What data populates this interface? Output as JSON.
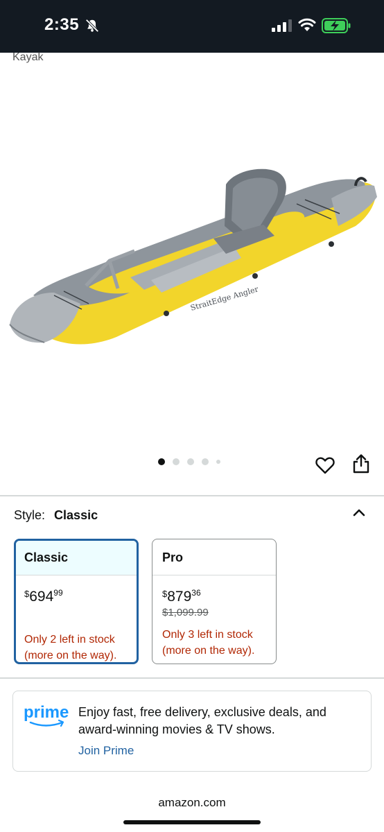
{
  "status_bar": {
    "time": "2:35"
  },
  "product": {
    "breadcrumb": "Kayak",
    "image_alt": "StraitEdge Angler",
    "gallery": {
      "count": 5,
      "active_index": 0
    }
  },
  "style_selector": {
    "label": "Style:",
    "selected": "Classic",
    "options": [
      {
        "name": "Classic",
        "price_symbol": "$",
        "price_whole": "694",
        "price_fraction": "99",
        "stock_line1": "Only 2 left in stock",
        "stock_line2": "(more on the way)."
      },
      {
        "name": "Pro",
        "price_symbol": "$",
        "price_whole": "879",
        "price_fraction": "36",
        "list_price": "$1,099.99",
        "stock_line1": "Only 3 left in stock",
        "stock_line2": "(more on the way)."
      }
    ]
  },
  "prime": {
    "logo": "prime",
    "text": "Enjoy fast, free delivery, exclusive deals, and award-winning movies & TV shows.",
    "cta": "Join Prime"
  },
  "browser": {
    "url": "amazon.com"
  },
  "colors": {
    "status_bar_bg": "#131a22",
    "link_blue": "#2162a1",
    "stock_red": "#b12704",
    "kayak_yellow": "#f2d52b",
    "kayak_gray": "#8e959c"
  }
}
